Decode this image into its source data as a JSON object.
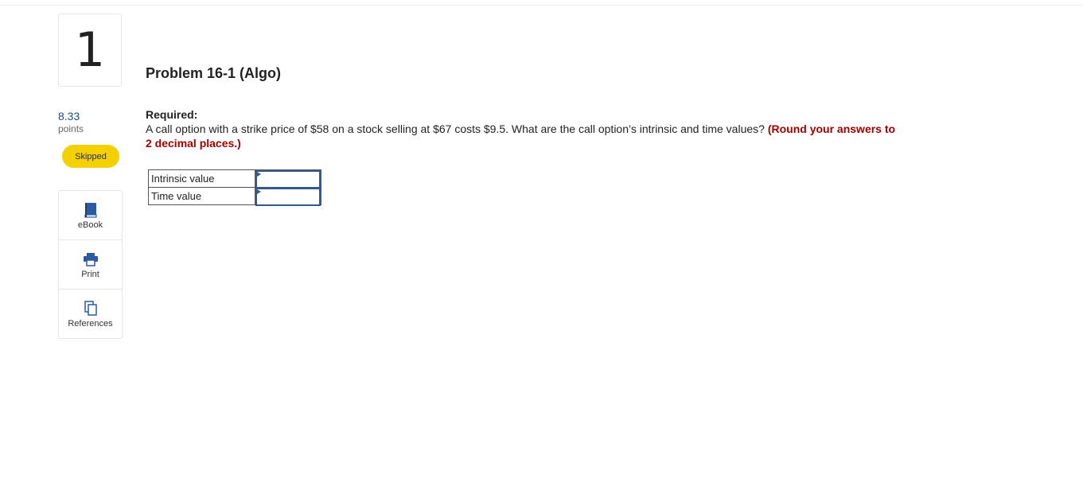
{
  "question": {
    "number": "1",
    "points_value": "8.33",
    "points_label": "points",
    "status": "Skipped",
    "title": "Problem 16-1 (Algo)",
    "required_label": "Required:",
    "text": "A call option with a strike price of $58 on a stock selling at $67 costs $9.5. What are the call option’s intrinsic and time values?",
    "round_note": "(Round your answers to 2 decimal places.)"
  },
  "resources": [
    {
      "label": "eBook",
      "icon": "book-icon"
    },
    {
      "label": "Print",
      "icon": "printer-icon"
    },
    {
      "label": "References",
      "icon": "copy-icon"
    }
  ],
  "answer_table": {
    "rows": [
      {
        "label": "Intrinsic value",
        "value": ""
      },
      {
        "label": "Time value",
        "value": ""
      }
    ]
  },
  "colors": {
    "points_blue": "#1f4e79",
    "skipped_yellow": "#f5d000",
    "round_red": "#a30000",
    "icon_blue": "#2c5aa0",
    "input_border": "#355a8a"
  }
}
